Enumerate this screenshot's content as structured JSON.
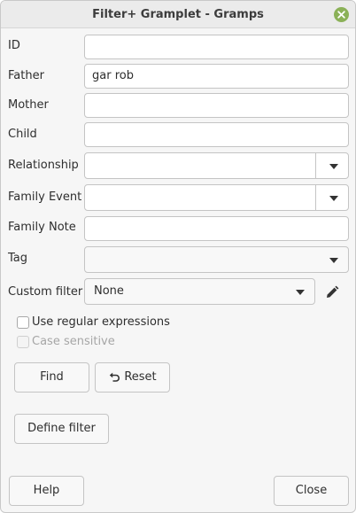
{
  "window": {
    "title": "Filter+ Gramplet - Gramps",
    "close_icon": "close-icon"
  },
  "fields": {
    "id": {
      "label": "ID",
      "value": ""
    },
    "father": {
      "label": "Father",
      "value": "gar rob"
    },
    "mother": {
      "label": "Mother",
      "value": ""
    },
    "child": {
      "label": "Child",
      "value": ""
    },
    "relationship": {
      "label": "Relationship",
      "value": ""
    },
    "family_event": {
      "label": "Family Event",
      "value": ""
    },
    "family_note": {
      "label": "Family Note",
      "value": ""
    },
    "tag": {
      "label": "Tag",
      "value": ""
    },
    "custom_filter": {
      "label": "Custom filter",
      "value": "None",
      "edit_icon": "pencil-icon"
    }
  },
  "options": {
    "use_regex": {
      "label": "Use regular expressions",
      "checked": false
    },
    "case_sensitive": {
      "label": "Case sensitive",
      "checked": false,
      "disabled": true
    }
  },
  "buttons": {
    "find": "Find",
    "reset": "Reset",
    "define_filter": "Define filter",
    "help": "Help",
    "close": "Close"
  },
  "colors": {
    "close_accent": "#8bb158",
    "window_bg": "#f6f6f6"
  }
}
